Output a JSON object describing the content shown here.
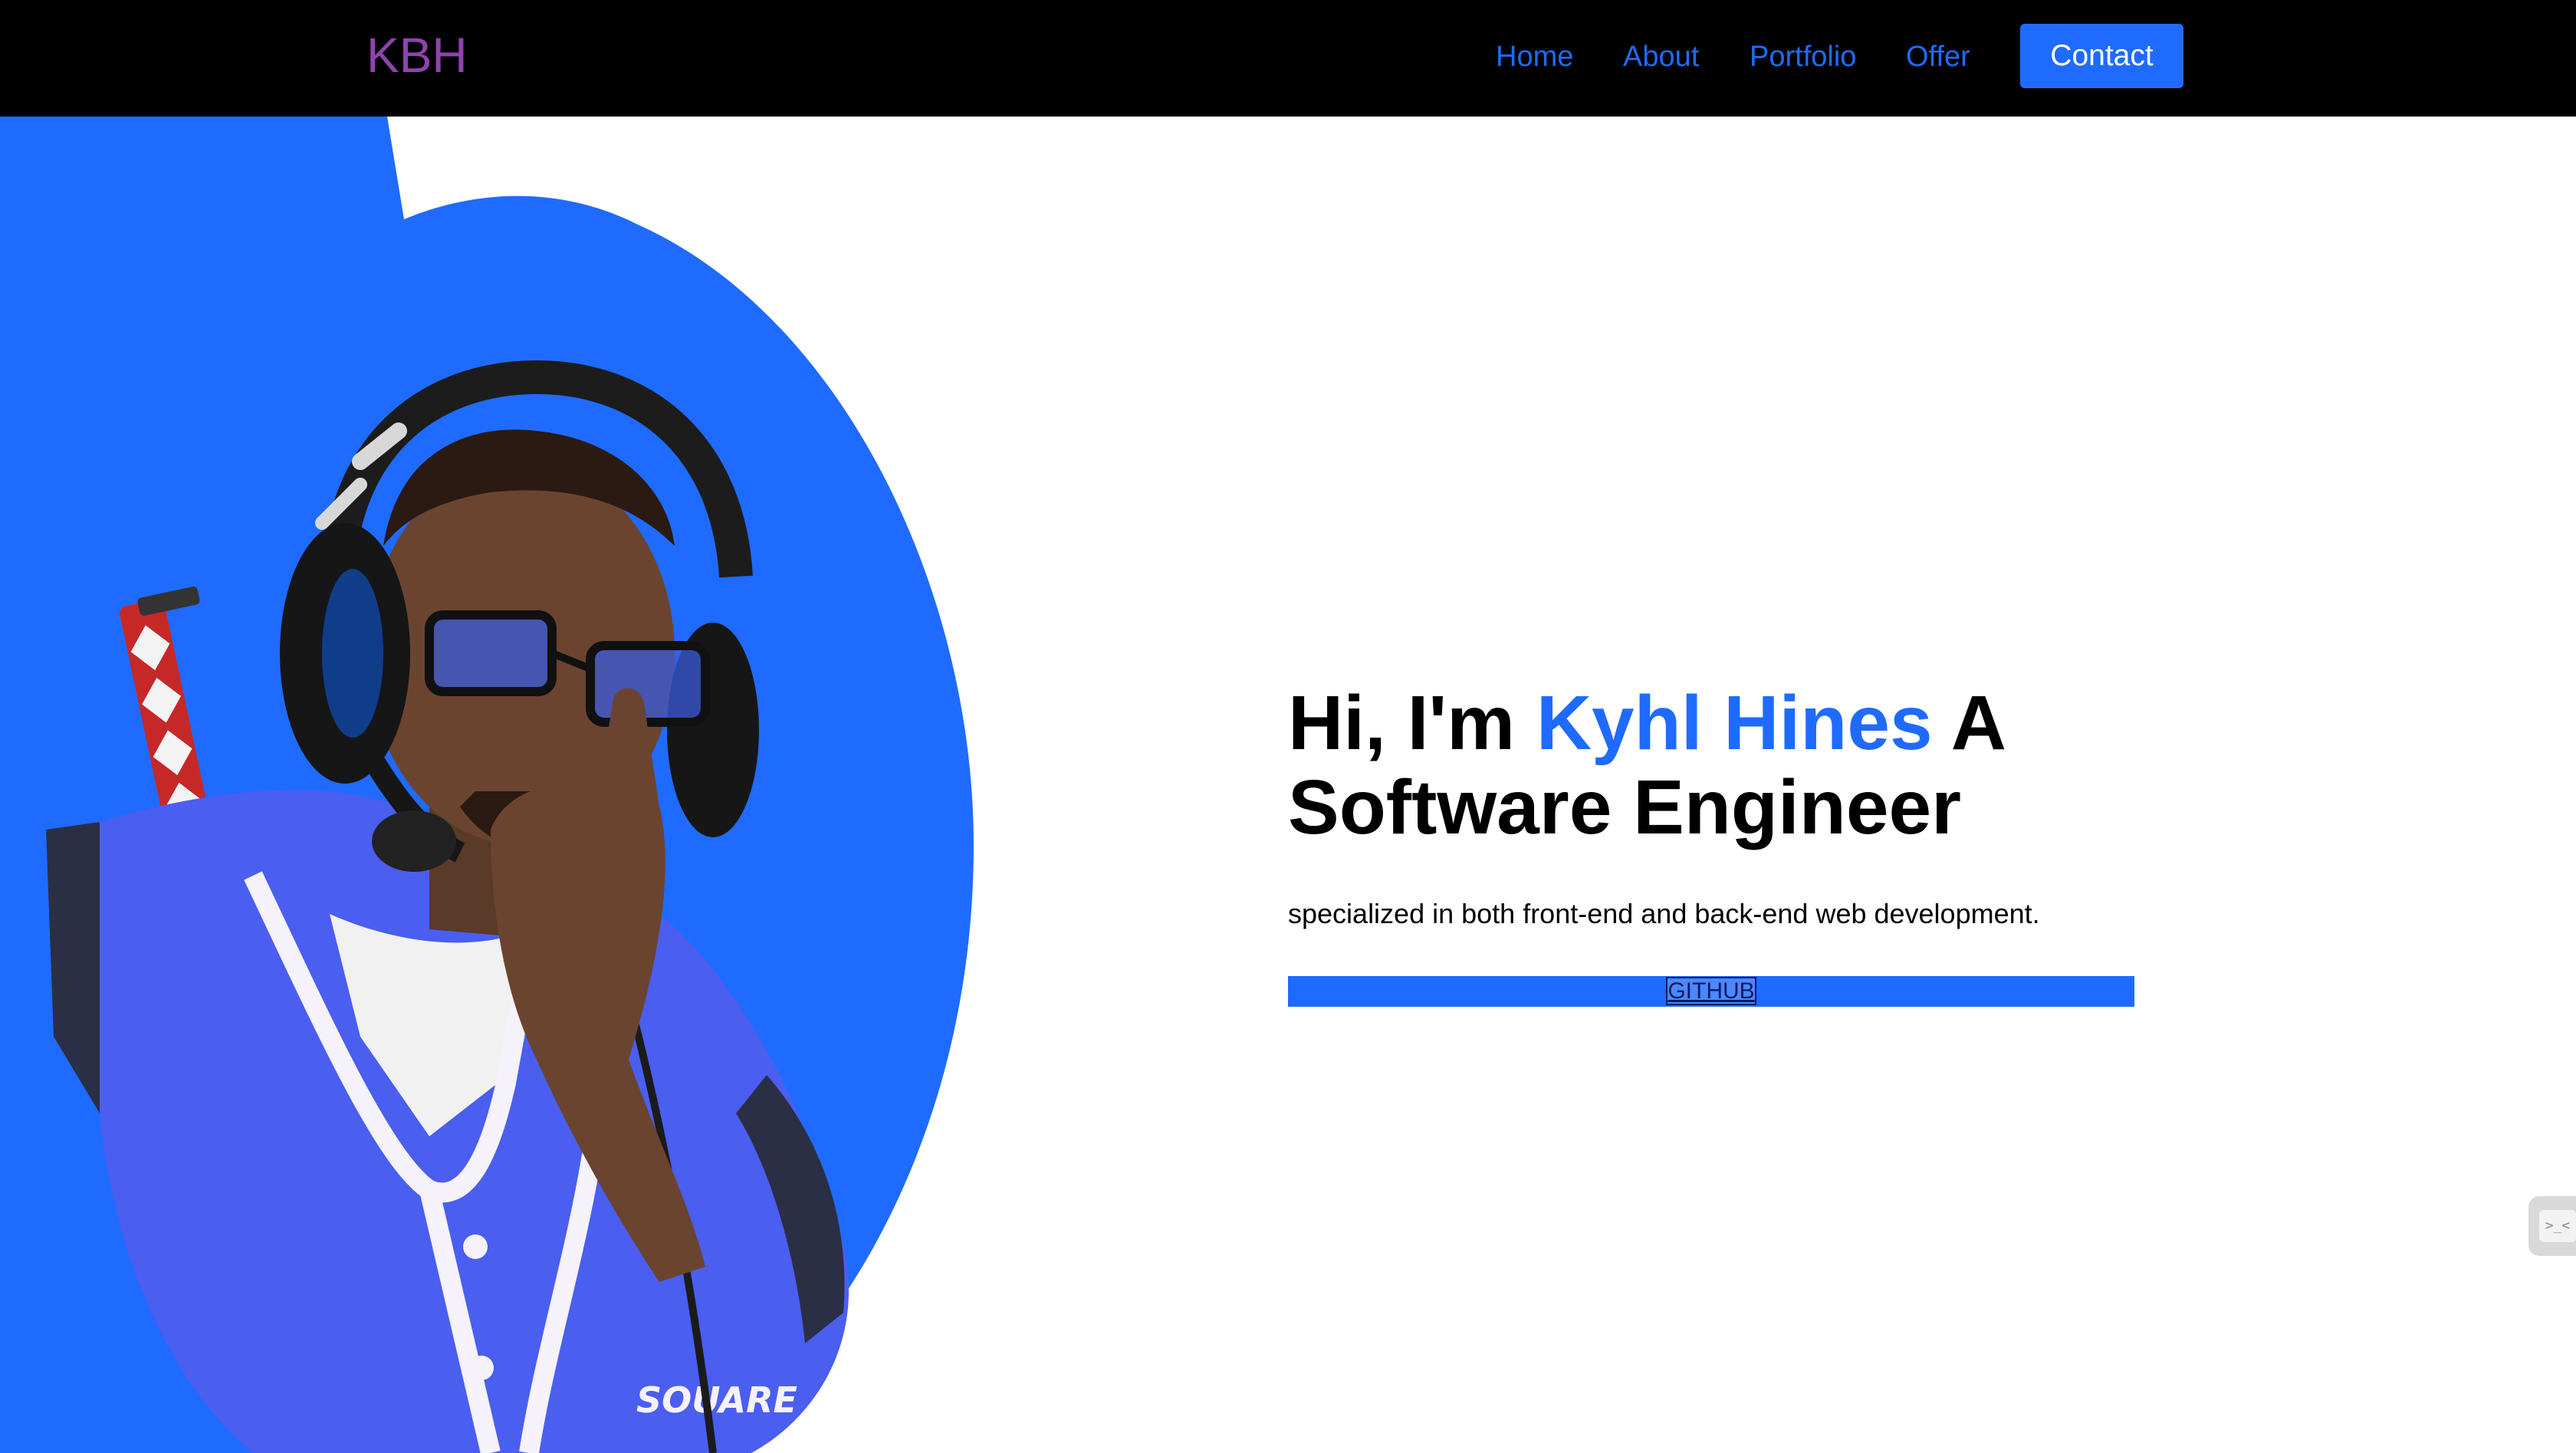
{
  "nav": {
    "logo": "KBH",
    "links": [
      "Home",
      "About",
      "Portfolio",
      "Offer"
    ],
    "contact_label": "Contact"
  },
  "hero": {
    "headline_prefix": "Hi, I'm ",
    "name": "Kyhl Hines",
    "headline_suffix": " A Software Engineer",
    "subtitle": "specialized in both front-end and back-end web development.",
    "github_label": "GITHUB",
    "portrait_jersey_text": "SOUARE"
  },
  "widget": {
    "glyph": ">_<"
  },
  "colors": {
    "accent": "#1f6bff",
    "logo": "#8e44ad",
    "nav_bg": "#000000",
    "jersey": "#4a5ef0"
  }
}
